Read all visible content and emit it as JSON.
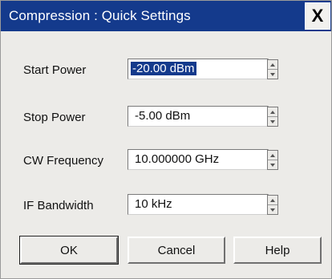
{
  "dialog": {
    "title": "Compression : Quick Settings",
    "close_label": "X"
  },
  "fields": [
    {
      "label": "Start Power",
      "value": "-20.00 dBm",
      "selected": true
    },
    {
      "label": "Stop Power",
      "value": "-5.00 dBm",
      "selected": false
    },
    {
      "label": "CW Frequency",
      "value": "10.000000 GHz",
      "selected": false
    },
    {
      "label": "IF Bandwidth",
      "value": "10 kHz",
      "selected": false
    }
  ],
  "buttons": {
    "ok": "OK",
    "cancel": "Cancel",
    "help": "Help"
  },
  "colors": {
    "titlebar": "#143a8c",
    "dialog_bg": "#ecebe8",
    "selection": "#143a8c"
  }
}
